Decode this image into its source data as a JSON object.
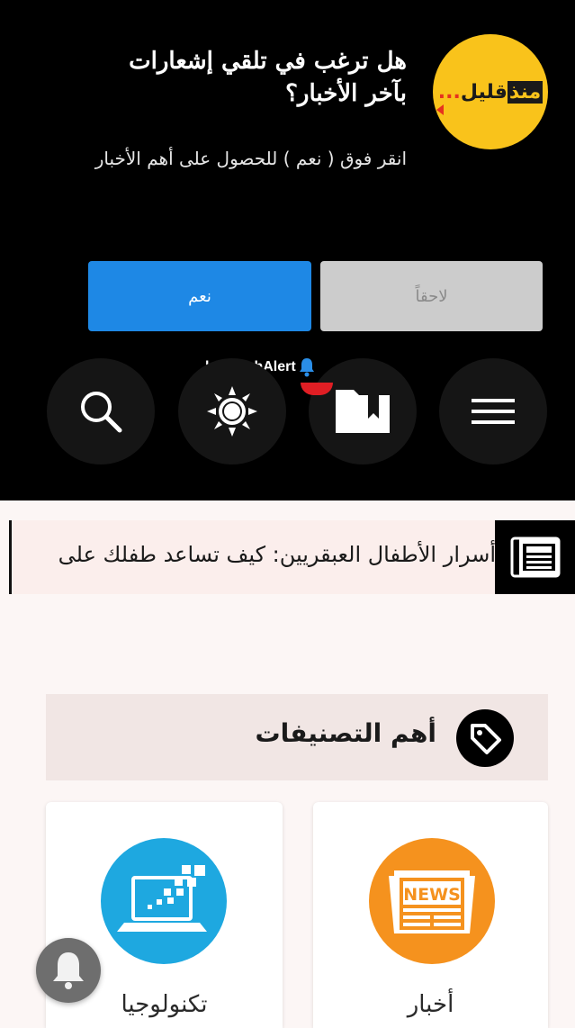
{
  "push_prompt": {
    "logo_text_highlight": "منذ",
    "logo_text_rest": "قليل",
    "logo_dots": "...",
    "title": "هل ترغب في تلقي إشعارات بآخر الأخبار؟",
    "description": "انقر فوق ( نعم ) للحصول على أهم الأخبار",
    "yes_label": "نعم",
    "later_label": "لاحقاً",
    "brand_prefix": "by ",
    "brand_name": "PushAlert"
  },
  "header_icons": [
    "search-icon",
    "sun-icon",
    "bookmark-icon",
    "menu-icon"
  ],
  "ticker": {
    "text": "أسرار الأطفال العبقريين: كيف تساعد طفلك على"
  },
  "categories": {
    "title": "أهم التصنيفات",
    "items": [
      {
        "label": "أخبار",
        "badge": "NEWS"
      },
      {
        "label": "تكنولوجيا"
      }
    ]
  },
  "colors": {
    "header_bg": "#000000",
    "logo_yellow": "#f9c31b",
    "yes_button": "#1e88e5",
    "later_button": "#cccccc",
    "content_bg": "#fcf6f5",
    "ticker_bg": "#fbeeec",
    "news_orange": "#f5921e",
    "tech_blue": "#1ea8e0",
    "notification_red": "#e01e24"
  }
}
